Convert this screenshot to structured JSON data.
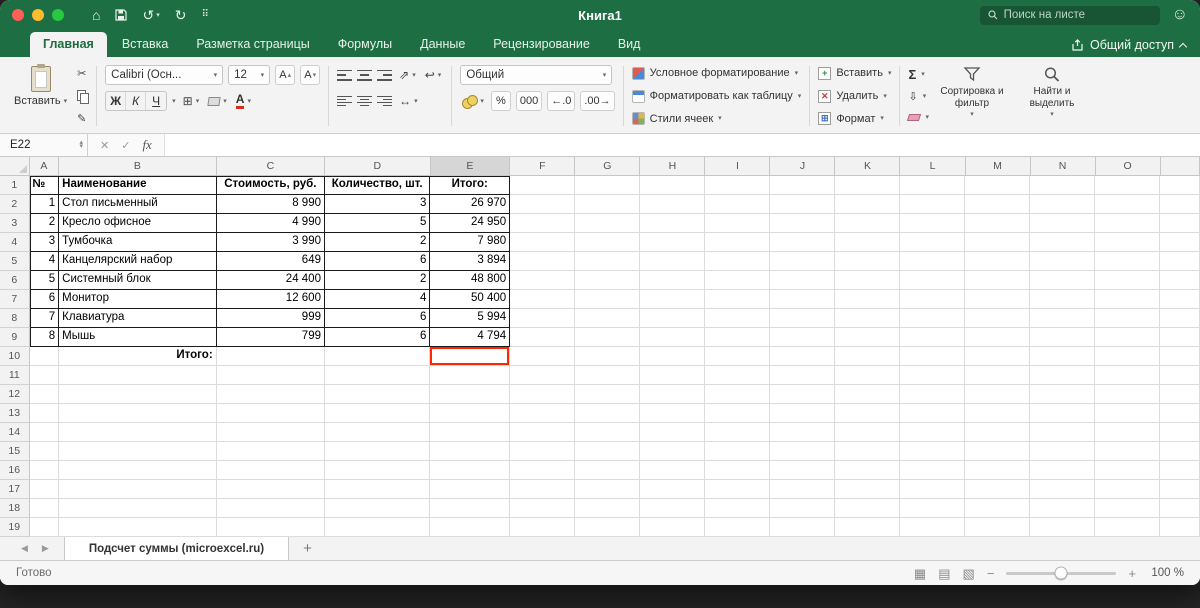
{
  "window": {
    "title": "Книга1",
    "search_placeholder": "Поиск на листе",
    "share_label": "Общий доступ"
  },
  "ribbon_tabs": [
    {
      "name": "home",
      "label": "Главная",
      "active": true
    },
    {
      "name": "insert",
      "label": "Вставка",
      "active": false
    },
    {
      "name": "page-layout",
      "label": "Разметка страницы",
      "active": false
    },
    {
      "name": "formulas",
      "label": "Формулы",
      "active": false
    },
    {
      "name": "data",
      "label": "Данные",
      "active": false
    },
    {
      "name": "review",
      "label": "Рецензирование",
      "active": false
    },
    {
      "name": "view",
      "label": "Вид",
      "active": false
    }
  ],
  "ribbon": {
    "paste_label": "Вставить",
    "font_name": "Calibri (Осн...",
    "font_size": "12",
    "bold_label": "Ж",
    "italic_label": "К",
    "underline_label": "Ч",
    "number_format": "Общий",
    "percent_label": "%",
    "thousands_label": "000",
    "conditional_formatting_label": "Условное форматирование",
    "format_as_table_label": "Форматировать как таблицу",
    "cell_styles_label": "Стили ячеек",
    "insert_label": "Вставить",
    "delete_label": "Удалить",
    "format_label": "Формат",
    "autosum_label": "Σ",
    "sort_filter_label": "Сортировка и фильтр",
    "find_select_label": "Найти и выделить"
  },
  "formula_bar": {
    "name_box_value": "E22",
    "fx_label": "fx"
  },
  "grid": {
    "column_letters": [
      "A",
      "B",
      "C",
      "D",
      "E",
      "F",
      "G",
      "H",
      "I",
      "J",
      "K",
      "L",
      "M",
      "N",
      "O"
    ],
    "row_numbers": [
      "1",
      "2",
      "3",
      "4",
      "5",
      "6",
      "7",
      "8",
      "9",
      "10",
      "11",
      "12",
      "13",
      "14",
      "15",
      "16",
      "17",
      "18",
      "19"
    ],
    "selected_column": "E",
    "red_outline_cell": "E10",
    "red_outline_color": "#ff2600"
  },
  "table": {
    "headers": [
      "№",
      "Наименование",
      "Стоимость, руб.",
      "Количество, шт.",
      "Итого:"
    ],
    "rows": [
      [
        "1",
        "Стол письменный",
        "8 990",
        "3",
        "26 970"
      ],
      [
        "2",
        "Кресло офисное",
        "4 990",
        "5",
        "24 950"
      ],
      [
        "3",
        "Тумбочка",
        "3 990",
        "2",
        "7 980"
      ],
      [
        "4",
        "Канцелярский набор",
        "649",
        "6",
        "3 894"
      ],
      [
        "5",
        "Системный блок",
        "24 400",
        "2",
        "48 800"
      ],
      [
        "6",
        "Монитор",
        "12 600",
        "4",
        "50 400"
      ],
      [
        "7",
        "Клавиатура",
        "999",
        "6",
        "5 994"
      ],
      [
        "8",
        "Мышь",
        "799",
        "6",
        "4 794"
      ]
    ],
    "footer_label": "Итого:"
  },
  "sheet_tabs": {
    "active_tab": "Подсчет суммы (microexcel.ru)",
    "add_tab_label": "+"
  },
  "status_bar": {
    "status": "Готово",
    "zoom_level": "100 %"
  },
  "colors": {
    "titlebar_green": "#1e6e44",
    "red_outline": "#ff2600"
  },
  "icons": {
    "caret": "▾",
    "up": "▴",
    "down": "▾",
    "home": "⌂",
    "undo": "↺",
    "redo": "↻",
    "menu_dots": "⠿",
    "cut": "✂",
    "format_painter": "✎",
    "letter_A": "А",
    "borders": "⊞",
    "orientation": "⇗",
    "wrap": "↩",
    "merge": "↔",
    "add_decimal": "←.0",
    "remove_decimal": ".00→",
    "fill": "⇩",
    "close_x": "✕",
    "check": "✓",
    "left_arrow": "◀",
    "right_arrow": "▶",
    "minus": "−",
    "plus": "+",
    "smiley": "☺",
    "normal_view": "▦",
    "layout_view": "▤",
    "break_view": "▧"
  }
}
